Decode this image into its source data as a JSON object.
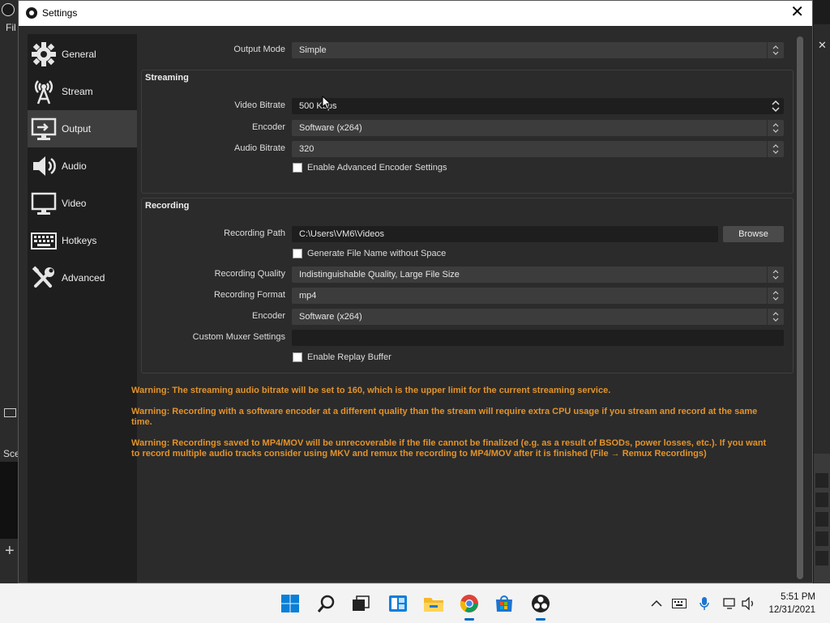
{
  "background": {
    "left_menu_text": "Fil",
    "left_scenes_text": "Sce"
  },
  "dialog": {
    "title": "Settings"
  },
  "sidebar": {
    "items": [
      {
        "label": "General",
        "icon": "gear-icon",
        "active": false
      },
      {
        "label": "Stream",
        "icon": "broadcast-tower-icon",
        "active": false
      },
      {
        "label": "Output",
        "icon": "monitor-output-icon",
        "active": true
      },
      {
        "label": "Audio",
        "icon": "speaker-icon",
        "active": false
      },
      {
        "label": "Video",
        "icon": "monitor-icon",
        "active": false
      },
      {
        "label": "Hotkeys",
        "icon": "keyboard-icon",
        "active": false
      },
      {
        "label": "Advanced",
        "icon": "tools-icon",
        "active": false
      }
    ]
  },
  "output_mode": {
    "label": "Output Mode",
    "value": "Simple"
  },
  "streaming": {
    "title": "Streaming",
    "video_bitrate": {
      "label": "Video Bitrate",
      "value": "500 Kbps"
    },
    "encoder": {
      "label": "Encoder",
      "value": "Software (x264)"
    },
    "audio_bitrate": {
      "label": "Audio Bitrate",
      "value": "320"
    },
    "advanced_encoder": {
      "label": "Enable Advanced Encoder Settings",
      "checked": false
    }
  },
  "recording": {
    "title": "Recording",
    "path": {
      "label": "Recording Path",
      "value": "C:\\Users\\VM6\\Videos",
      "browse": "Browse"
    },
    "no_space": {
      "label": "Generate File Name without Space",
      "checked": false
    },
    "quality": {
      "label": "Recording Quality",
      "value": "Indistinguishable Quality, Large File Size"
    },
    "format": {
      "label": "Recording Format",
      "value": "mp4"
    },
    "encoder": {
      "label": "Encoder",
      "value": "Software (x264)"
    },
    "muxer": {
      "label": "Custom Muxer Settings",
      "value": ""
    },
    "replay_buffer": {
      "label": "Enable Replay Buffer",
      "checked": false
    }
  },
  "warnings": [
    "Warning: The streaming audio bitrate will be set to 160, which is the upper limit for the current streaming service.",
    "Warning: Recording with a software encoder at a different quality than the stream will require extra CPU usage if you stream and record at the same time.",
    "Warning: Recordings saved to MP4/MOV will be unrecoverable if the file cannot be finalized (e.g. as a result of BSODs, power losses, etc.). If you want to record multiple audio tracks consider using MKV and remux the recording to MP4/MOV after it is finished (File → Remux Recordings)"
  ],
  "taskbar": {
    "apps": [
      "windows-start-icon",
      "search-icon",
      "task-view-icon",
      "widgets-icon",
      "file-explorer-icon",
      "chrome-icon",
      "microsoft-store-icon",
      "obs-icon"
    ],
    "time": "5:51 PM",
    "date": "12/31/2021"
  },
  "colors": {
    "warning": "#e2932b",
    "panel": "#2b2b2b",
    "sidebar": "#1e1e1e",
    "field": "#3c3c3c"
  }
}
